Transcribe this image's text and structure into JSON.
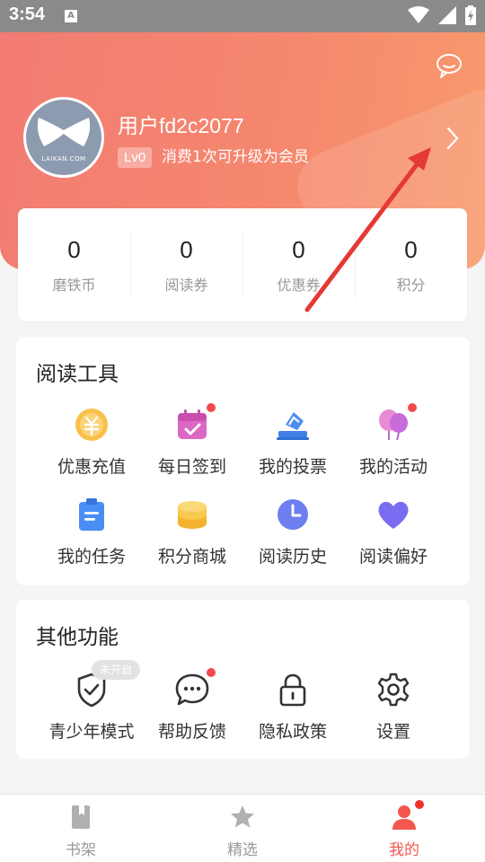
{
  "status_bar": {
    "time": "3:54",
    "notification_glyph": "A",
    "icons": [
      "wifi-icon",
      "cellular-signal-icon",
      "battery-charging-icon"
    ]
  },
  "header": {
    "username": "用户fd2c2077",
    "level": "Lv0",
    "level_tip": "消费1次可升级为会员",
    "avatar_text": "LAIKAN.COM",
    "icons": [
      "message-icon",
      "chevron-right-icon"
    ],
    "gradient_colors": [
      "#f27b73",
      "#f89a6d"
    ]
  },
  "stats": [
    {
      "value": "0",
      "label": "磨铁币"
    },
    {
      "value": "0",
      "label": "阅读券"
    },
    {
      "value": "0",
      "label": "优惠券"
    },
    {
      "value": "0",
      "label": "积分"
    }
  ],
  "reading_tools": {
    "title": "阅读工具",
    "items": [
      {
        "label": "优惠充值",
        "icon": "yuan-coin-icon",
        "dot": false
      },
      {
        "label": "每日签到",
        "icon": "calendar-check-icon",
        "dot": true
      },
      {
        "label": "我的投票",
        "icon": "ballot-box-icon",
        "dot": false
      },
      {
        "label": "我的活动",
        "icon": "balloons-icon",
        "dot": true
      },
      {
        "label": "我的任务",
        "icon": "clipboard-icon",
        "dot": false
      },
      {
        "label": "积分商城",
        "icon": "coin-stack-icon",
        "dot": false
      },
      {
        "label": "阅读历史",
        "icon": "clock-icon",
        "dot": false
      },
      {
        "label": "阅读偏好",
        "icon": "heart-icon",
        "dot": false
      }
    ]
  },
  "other_functions": {
    "title": "其他功能",
    "items": [
      {
        "label": "青少年模式",
        "icon": "shield-check-icon",
        "badge": "未开启"
      },
      {
        "label": "帮助反馈",
        "icon": "chat-bubble-icon",
        "dot": true
      },
      {
        "label": "隐私政策",
        "icon": "lock-icon"
      },
      {
        "label": "设置",
        "icon": "gear-icon"
      }
    ]
  },
  "bottom_nav": [
    {
      "label": "书架",
      "icon": "bookshelf-icon",
      "active": false
    },
    {
      "label": "精选",
      "icon": "star-icon",
      "active": false
    },
    {
      "label": "我的",
      "icon": "person-icon",
      "active": true,
      "dot": true
    }
  ],
  "colors": {
    "accent": "#f2584e",
    "badge_dot": "#f24a4a",
    "annotation_arrow": "#e53935"
  }
}
